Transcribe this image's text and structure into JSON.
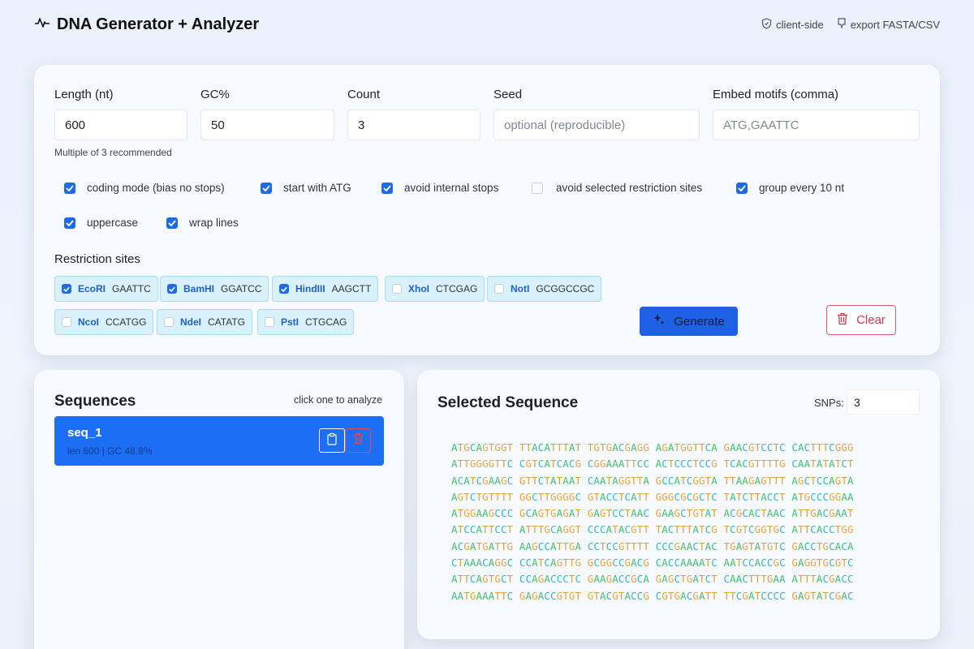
{
  "app": {
    "title": "DNA Generator + Analyzer",
    "links": [
      {
        "label": "client-side",
        "icon": "shield-icon"
      },
      {
        "label": "export FASTA/CSV",
        "icon": "download-icon"
      }
    ]
  },
  "form": {
    "length": {
      "label": "Length (nt)",
      "value": "600",
      "hint": "Multiple of 3 recommended"
    },
    "gc": {
      "label": "GC%",
      "value": "50"
    },
    "count": {
      "label": "Count",
      "value": "3"
    },
    "seed": {
      "label": "Seed",
      "value": "",
      "placeholder": "optional (reproducible)"
    },
    "motifs": {
      "label": "Embed motifs (comma)",
      "value": "",
      "placeholder": "ATG,GAATTC"
    },
    "options": [
      {
        "label": "coding mode (bias no stops)",
        "checked": true
      },
      {
        "label": "start with ATG",
        "checked": true
      },
      {
        "label": "avoid internal stops",
        "checked": true
      },
      {
        "label": "avoid selected restriction sites",
        "checked": false
      },
      {
        "label": "group every 10 nt",
        "checked": true
      },
      {
        "label": "uppercase",
        "checked": true
      },
      {
        "label": "wrap lines",
        "checked": true
      }
    ],
    "restriction_label": "Restriction sites",
    "sites": [
      {
        "name": "EcoRI",
        "seq": "GAATTC",
        "checked": true
      },
      {
        "name": "BamHI",
        "seq": "GGATCC",
        "checked": true
      },
      {
        "name": "HindIII",
        "seq": "AAGCTT",
        "checked": true
      },
      {
        "name": "XhoI",
        "seq": "CTCGAG",
        "checked": false
      },
      {
        "name": "NotI",
        "seq": "GCGGCCGC",
        "checked": false
      },
      {
        "name": "NcoI",
        "seq": "CCATGG",
        "checked": false
      },
      {
        "name": "NdeI",
        "seq": "CATATG",
        "checked": false
      },
      {
        "name": "PstI",
        "seq": "CTGCAG",
        "checked": false
      }
    ],
    "generate_label": "Generate",
    "clear_label": "Clear"
  },
  "sequences": {
    "title": "Sequences",
    "note": "click one to analyze",
    "items": [
      {
        "name": "seq_1",
        "meta": "len 600 | GC 48.8%"
      }
    ]
  },
  "selected": {
    "title": "Selected Sequence",
    "snp_label": "SNPs:",
    "snp_value": "3",
    "lines": [
      "ATGCAGTGGT TTACATTTAT TGTGACGAGG AGATGGTTCA GAACGTCCTC CACTTTCGGG",
      "ATTGGGGTTC CGTCATCACG CGGAAATTCC ACTCCCTCCG TCACGTTTTG CAATATATCT",
      "ACATCGAAGC GTTCTATAAT CAATAGGTTA GCCATCGGTA TTAAGAGTTT AGCTCCAGTA",
      "AGTCTGTTTT GGCTTGGGGC GTACCTCATT GGGCGCGCTC TATCTTACCT ATGCCCGGAA",
      "ATGGAAGCCC GCAGTGAGAT GAGTCCTAAC GAAGCTGTAT ACGCACTAAC ATTGACGAAT",
      "ATCCATTCCT ATTTGCAGGT CCCATACGTT TACTTTATCG TCGTCGGTGC ATTCACCTGG",
      "ACGATGATTG AAGCCATTGA CCTCCGTTTT CCCGAACTAC TGAGTATGTC GACCTGCACA",
      "CTAAACAGGC CCATCAGTTG GCGGCCGACG CACCAAAATC AATCCACCGC GAGGTGCGTC",
      "ATTCAGTGCT CCAGACCCTC GAAGACCGCA GAGCTGATCT CAACTTTGAA ATTTACGACC",
      "AATGAAATTC GAGACCGTGT GTACGTACCG CGTGACGATT TTCGATCCCC GAGTATCGAC"
    ]
  },
  "colors": {
    "accent": "#1e61e4",
    "danger": "#d23a4a",
    "nucA": "#3fbf6a",
    "nucT": "#e0a038",
    "nucG": "#f0a43a",
    "nucC": "#35b6c9"
  }
}
